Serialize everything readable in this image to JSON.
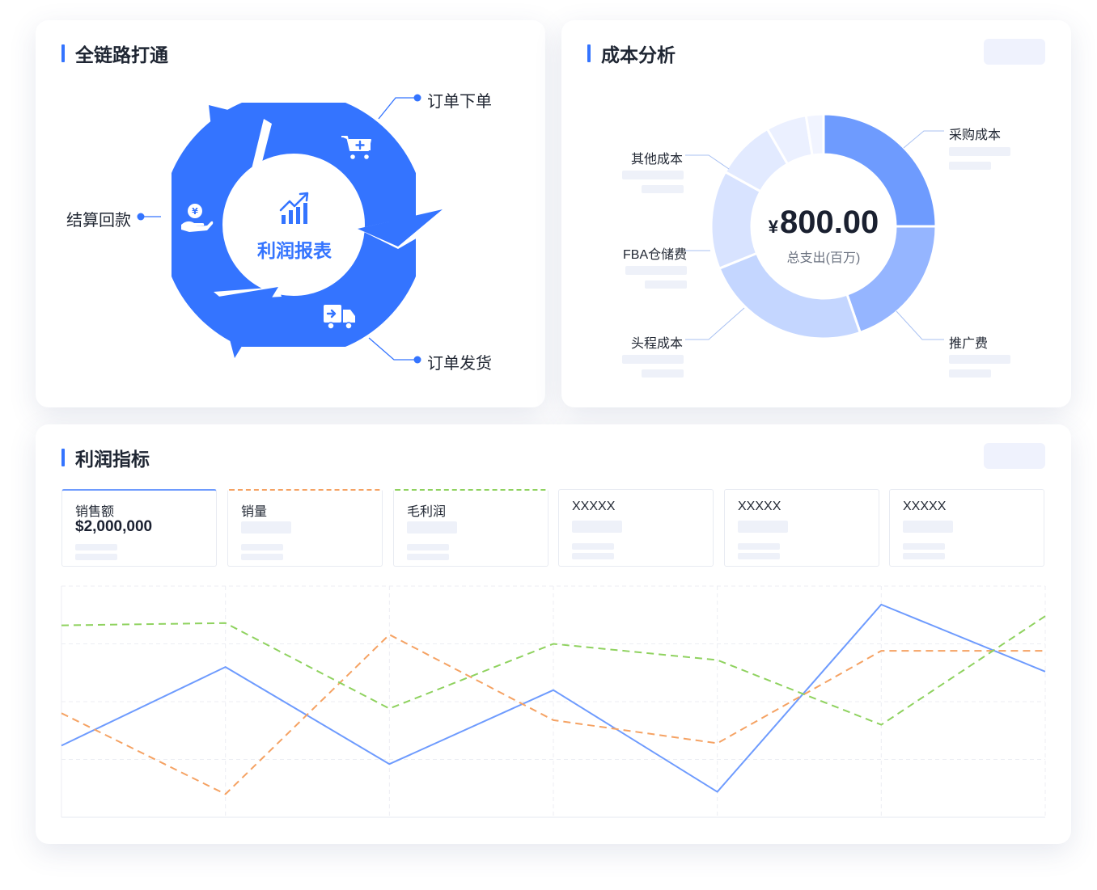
{
  "cycle_card": {
    "title": "全链路打通",
    "center_label": "利润报表",
    "steps": [
      "订单下单",
      "订单发货",
      "结算回款"
    ]
  },
  "cost_card": {
    "title": "成本分析",
    "total_symbol": "¥",
    "total_value": "800.00",
    "total_caption": "总支出(百万)",
    "segments": [
      {
        "label": "采购成本",
        "color": "#6e9bfe"
      },
      {
        "label": "推广费",
        "color": "#95b5ff"
      },
      {
        "label": "头程成本",
        "color": "#c4d6ff"
      },
      {
        "label": "FBA仓储费",
        "color": "#d8e3ff"
      },
      {
        "label": "其他成本",
        "color": "#e2eaff"
      },
      {
        "label": "",
        "color": "#ebf0ff"
      },
      {
        "label": "",
        "color": "#f1f4ff"
      }
    ]
  },
  "profit_card": {
    "title": "利润指标",
    "metrics": [
      {
        "label": "销售额",
        "value": "$2,000,000"
      },
      {
        "label": "销量",
        "value": ""
      },
      {
        "label": "毛利润",
        "value": ""
      },
      {
        "label": "XXXXX",
        "value": ""
      },
      {
        "label": "XXXXX",
        "value": ""
      },
      {
        "label": "XXXXX",
        "value": ""
      }
    ]
  },
  "colors": {
    "accent": "#3474ff",
    "series_blue": "#6e9bfe",
    "series_orange": "#f5a263",
    "series_green": "#8fd25f"
  },
  "chart_data": {
    "type": "line",
    "x": [
      0,
      1,
      2,
      3,
      4,
      5,
      6
    ],
    "ylim": [
      0,
      100
    ],
    "grid": true,
    "series": [
      {
        "color": "#6e9bfe",
        "dash": "solid",
        "values": [
          31,
          65,
          23,
          55,
          11,
          92,
          63
        ]
      },
      {
        "color": "#f5a263",
        "dash": "dashed",
        "values": [
          45,
          10,
          79,
          42,
          32,
          72,
          72
        ]
      },
      {
        "color": "#8fd25f",
        "dash": "dashed",
        "values": [
          83,
          84,
          47,
          75,
          68,
          40,
          87
        ]
      }
    ]
  }
}
